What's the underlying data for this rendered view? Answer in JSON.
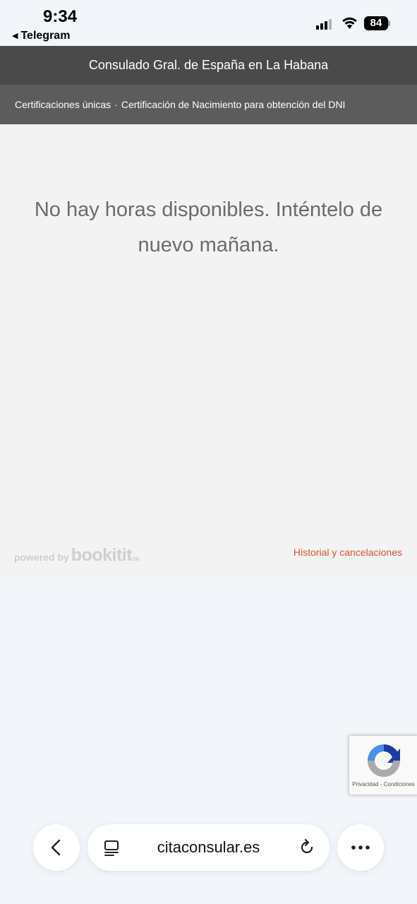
{
  "status_bar": {
    "time": "9:34",
    "back_app": "Telegram",
    "battery": "84",
    "icons": [
      "cellular-signal-icon",
      "wifi-icon",
      "battery-icon"
    ]
  },
  "header": {
    "title": "Consulado Gral. de España en La Habana"
  },
  "breadcrumb": {
    "items": [
      "Certificaciones únicas",
      "Certificación de Nacimiento para obtención del DNI"
    ],
    "separator": "·"
  },
  "main": {
    "message": "No hay horas disponibles. Inténtelo de nuevo mañana."
  },
  "footer": {
    "powered_by": "powered by",
    "brand": "bookitit",
    "history_link": "Historial y cancelaciones"
  },
  "recaptcha": {
    "privacy": "Privacidad",
    "separator": "-",
    "terms": "Condiciones"
  },
  "browser_toolbar": {
    "url": "citaconsular.es",
    "icons": [
      "back-arrow-icon",
      "tabs-icon",
      "reload-icon",
      "more-icon"
    ]
  },
  "colors": {
    "header_bg": "#4a4a4a",
    "breadcrumb_bg": "#5c5c5c",
    "content_bg": "#f3f3f4",
    "message_text": "#6b6b6b",
    "link": "#d9532f"
  }
}
